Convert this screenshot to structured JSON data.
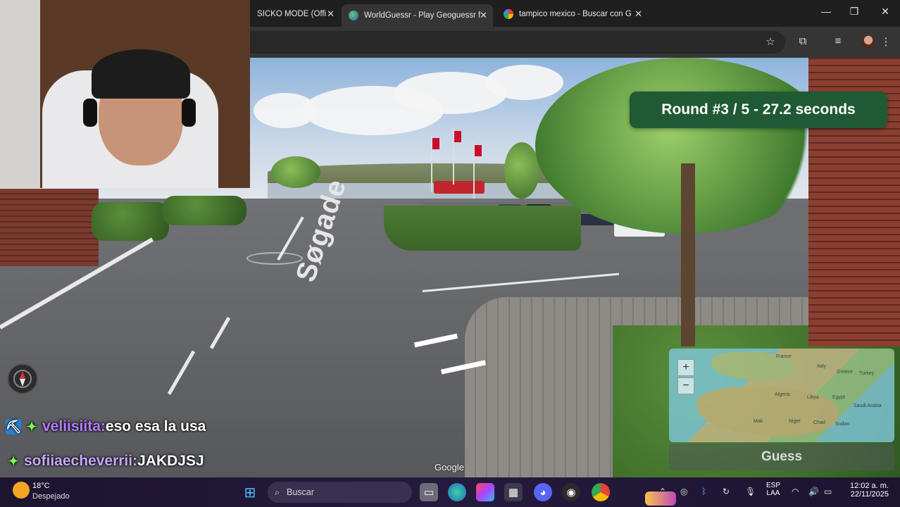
{
  "browser": {
    "tabs": [
      {
        "title": "SICKO MODE (Offi",
        "active": false
      },
      {
        "title": "WorldGuessr - Play Geoguessr f",
        "active": true
      },
      {
        "title": "tampico mexico - Buscar con G",
        "active": false
      }
    ],
    "new_tab": "+",
    "window_controls": {
      "minimize": "—",
      "maximize": "❐",
      "close": "✕"
    }
  },
  "game": {
    "round_text": "Round #3 / 5 - 27.2 seconds",
    "guess_label": "Guess",
    "google_watermark": "Google",
    "street_name": "Søgade",
    "minimap": {
      "zoom_in": "+",
      "zoom_out": "−",
      "labels": [
        "France",
        "Italy",
        "Greece",
        "Turkey",
        "Algeria",
        "Libya",
        "Egypt",
        "Saudi Arabia",
        "Mali",
        "Niger",
        "Chad",
        "Sudan"
      ]
    }
  },
  "chat": [
    {
      "user": "veliisiita:",
      "message": " eso esa la usa",
      "user_color": "#b57bff",
      "icon": "bit-icon"
    },
    {
      "user": "sofiiaecheverrii:",
      "message": " JAKDJSJ",
      "user_color": "#c9a6ff",
      "icon": "sparkle-icon"
    }
  ],
  "taskbar": {
    "weather_temp": "18°C",
    "weather_desc": "Despejado",
    "search_placeholder": "Buscar",
    "language": "ESP",
    "language_sub": "LAA",
    "time": "12:02 a. m.",
    "date": "22/11/2025"
  },
  "colors": {
    "round_badge": "#1f5a34",
    "taskbar": "#251a3d"
  }
}
